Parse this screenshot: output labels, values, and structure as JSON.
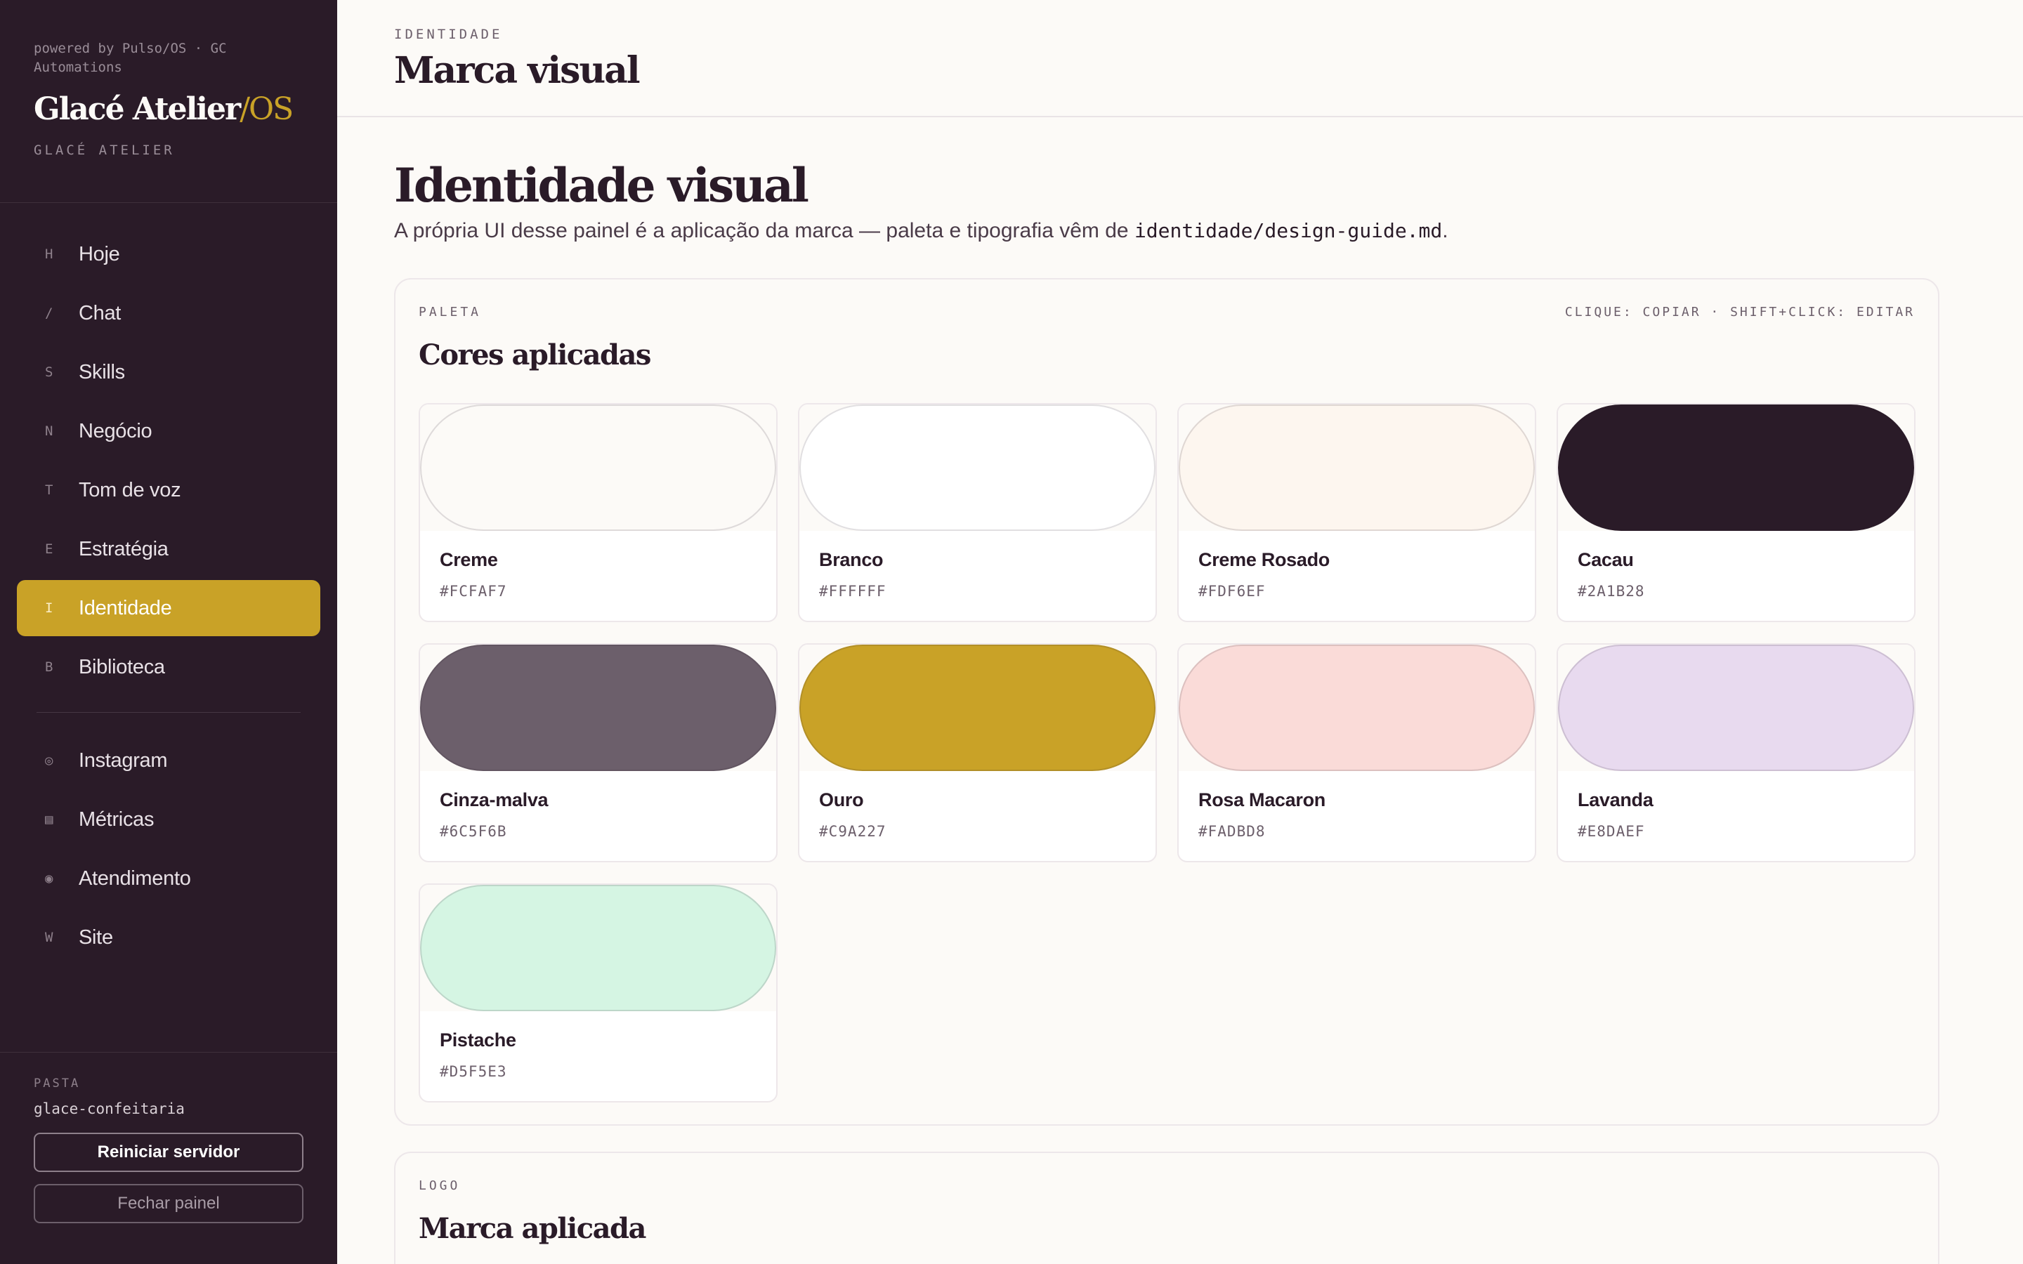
{
  "sidebar": {
    "powered_by": "powered by Pulso/OS · GC Automations",
    "brand_main": "Glacé Atelier",
    "brand_accent": "/OS",
    "brand_sub": "GLACÉ ATELIER",
    "items": [
      {
        "key": "H",
        "label": "Hoje",
        "icon": "key-h"
      },
      {
        "key": "/",
        "label": "Chat",
        "icon": "key-slash"
      },
      {
        "key": "S",
        "label": "Skills",
        "icon": "key-s"
      },
      {
        "key": "N",
        "label": "Negócio",
        "icon": "key-n"
      },
      {
        "key": "T",
        "label": "Tom de voz",
        "icon": "key-t"
      },
      {
        "key": "E",
        "label": "Estratégia",
        "icon": "key-e"
      },
      {
        "key": "I",
        "label": "Identidade",
        "icon": "key-i",
        "active": true
      },
      {
        "key": "B",
        "label": "Biblioteca",
        "icon": "key-b"
      }
    ],
    "secondary_items": [
      {
        "key": "◎",
        "label": "Instagram",
        "icon": "instagram-icon"
      },
      {
        "key": "▤",
        "label": "Métricas",
        "icon": "metrics-icon"
      },
      {
        "key": "◉",
        "label": "Atendimento",
        "icon": "support-icon"
      },
      {
        "key": "W",
        "label": "Site",
        "icon": "key-w"
      }
    ],
    "folder_label": "PASTA",
    "folder_value": "glace-confeitaria",
    "restart_label": "Reiniciar servidor",
    "close_label": "Fechar painel"
  },
  "header": {
    "breadcrumb": "IDENTIDADE",
    "title": "Marca visual"
  },
  "main": {
    "heading": "Identidade visual",
    "subtitle_prefix": "A própria UI desse painel é a aplicação da marca — paleta e tipografia vêm de ",
    "subtitle_code": "identidade/design-guide.md",
    "subtitle_suffix": "."
  },
  "palette": {
    "kicker": "PALETA",
    "hint": "CLIQUE: COPIAR · SHIFT+CLICK: EDITAR",
    "title": "Cores aplicadas",
    "colors": [
      {
        "name": "Creme",
        "hex": "#FCFAF7"
      },
      {
        "name": "Branco",
        "hex": "#FFFFFF"
      },
      {
        "name": "Creme Rosado",
        "hex": "#FDF6EF"
      },
      {
        "name": "Cacau",
        "hex": "#2A1B28"
      },
      {
        "name": "Cinza-malva",
        "hex": "#6C5F6B"
      },
      {
        "name": "Ouro",
        "hex": "#C9A227"
      },
      {
        "name": "Rosa Macaron",
        "hex": "#FADBD8"
      },
      {
        "name": "Lavanda",
        "hex": "#E8DAEF"
      },
      {
        "name": "Pistache",
        "hex": "#D5F5E3"
      }
    ]
  },
  "logo_section": {
    "kicker": "LOGO",
    "title": "Marca aplicada"
  },
  "colors": {
    "sidebar_bg": "#2A1B28",
    "accent": "#C9A227",
    "page_bg": "#FCFAF7"
  }
}
